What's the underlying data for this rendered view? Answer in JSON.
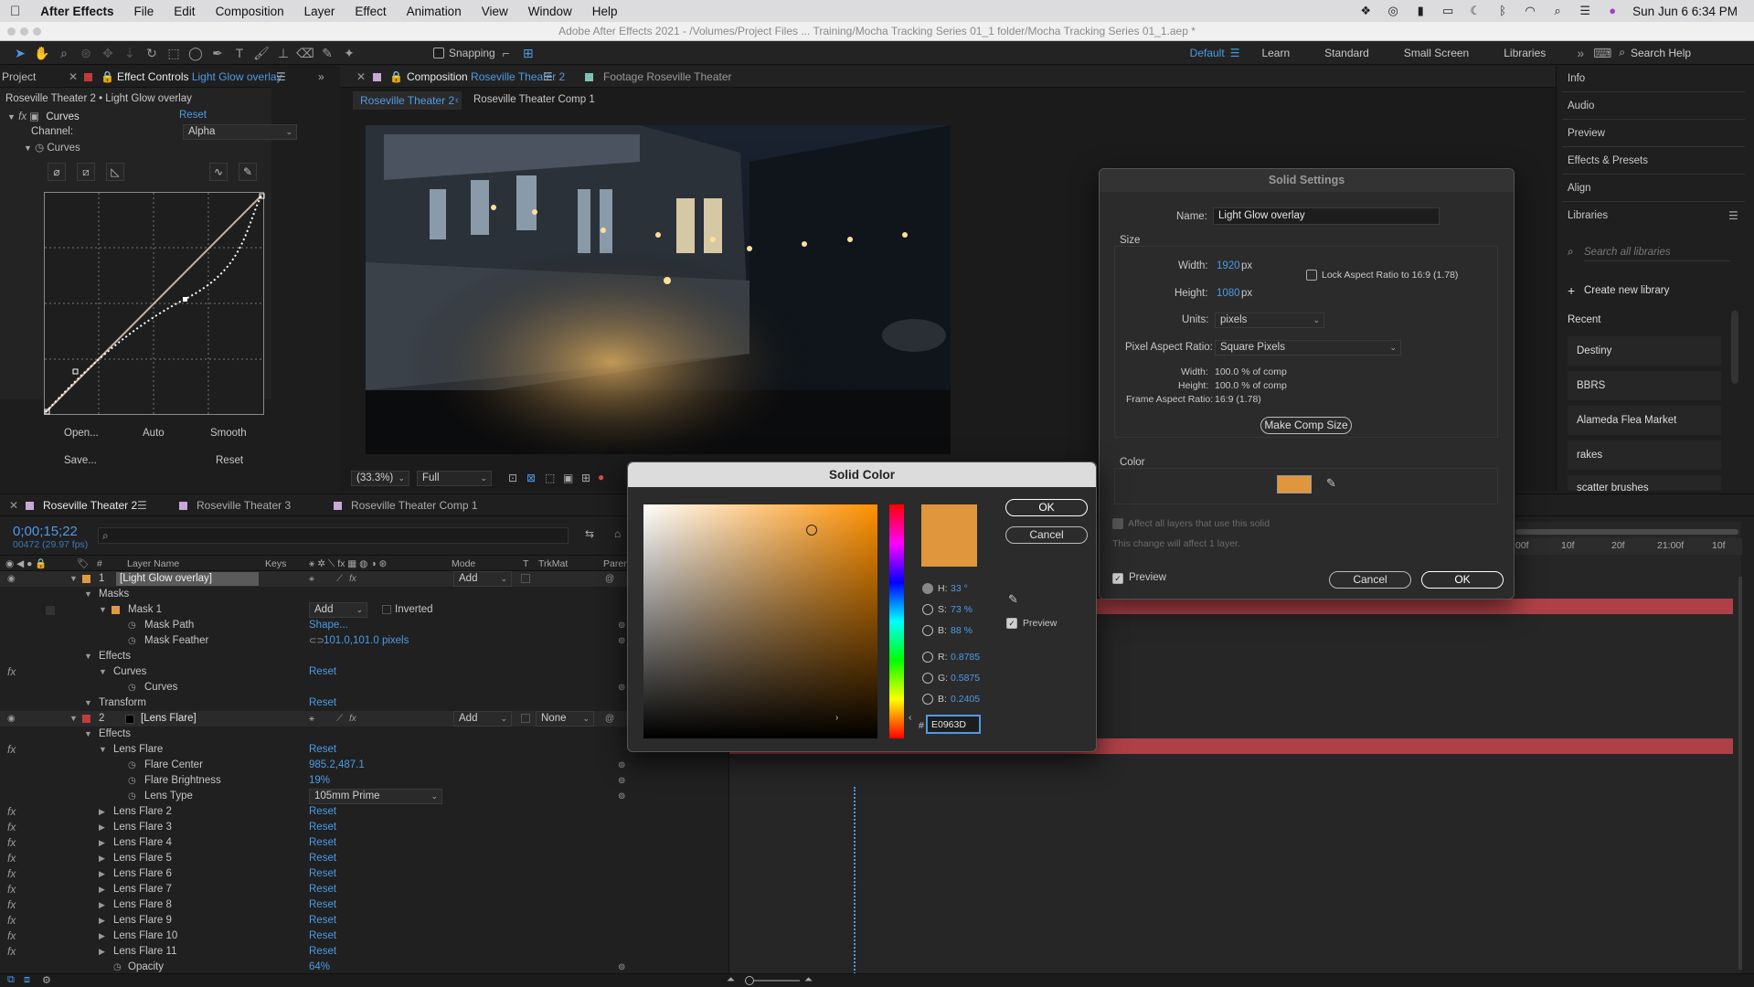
{
  "menubar": {
    "app": "After Effects",
    "items": [
      "File",
      "Edit",
      "Composition",
      "Layer",
      "Effect",
      "Animation",
      "View",
      "Window",
      "Help"
    ],
    "datetime": "Sun Jun 6  6:34 PM"
  },
  "titlebar": {
    "text": "Adobe After Effects 2021 - /Volumes/Project Files ... Training/Mocha Tracking Series 01_1 folder/Mocha Tracking Series 01_1.aep *"
  },
  "toolbar": {
    "snapping": "Snapping",
    "workspaces": [
      "Default",
      "Learn",
      "Standard",
      "Small Screen",
      "Libraries"
    ],
    "active_workspace": "Default",
    "search_help": "Search Help"
  },
  "left_panel": {
    "tab_project": "Project",
    "tab_effect_controls": "Effect Controls",
    "effect_layer": "Light Glow overlay",
    "header": "Roseville Theater 2 • Light Glow overlay",
    "effect_name": "Curves",
    "reset": "Reset",
    "channel_label": "Channel:",
    "channel_value": "Alpha",
    "curves_label": "Curves",
    "buttons": {
      "open": "Open...",
      "auto": "Auto",
      "smooth": "Smooth",
      "save": "Save...",
      "reset": "Reset"
    }
  },
  "composition": {
    "tab_label": "Composition",
    "comp_name": "Roseville Theater 2",
    "footage_tab": "Footage Roseville Theater",
    "breadcrumb_active": "Roseville Theater 2",
    "breadcrumb_next": "Roseville Theater Comp 1",
    "zoom": "(33.3%)",
    "resolution": "Full"
  },
  "right_panel": {
    "items": [
      "Info",
      "Audio",
      "Preview",
      "Effects & Presets",
      "Align",
      "Libraries"
    ],
    "search_placeholder": "Search all libraries",
    "create_library": "Create new library",
    "recent_label": "Recent",
    "libraries": [
      "Destiny",
      "BBRS",
      "Alameda Flea Market",
      "rakes",
      "scatter brushes"
    ]
  },
  "solid_settings": {
    "title": "Solid Settings",
    "name_label": "Name:",
    "name_value": "Light Glow overlay",
    "size_label": "Size",
    "width_label": "Width:",
    "width_value": "1920",
    "height_label": "Height:",
    "height_value": "1080",
    "px": "px",
    "lock_aspect": "Lock Aspect Ratio to 16:9 (1.78)",
    "units_label": "Units:",
    "units_value": "pixels",
    "par_label": "Pixel Aspect Ratio:",
    "par_value": "Square Pixels",
    "info_width_label": "Width:",
    "info_width_value": "100.0 % of comp",
    "info_height_label": "Height:",
    "info_height_value": "100.0 % of comp",
    "far_label": "Frame Aspect Ratio:",
    "far_value": "16:9 (1.78)",
    "make_comp_size": "Make Comp Size",
    "color_label": "Color",
    "swatch_color": "#E0963D",
    "affect_all": "Affect all layers that use this solid",
    "affect_note": "This change will affect 1 layer.",
    "preview": "Preview",
    "cancel": "Cancel",
    "ok": "OK"
  },
  "solid_color": {
    "title": "Solid Color",
    "ok": "OK",
    "cancel": "Cancel",
    "h_label": "H:",
    "h_value": "33 °",
    "s_label": "S:",
    "s_value": "73 %",
    "b_label": "B:",
    "b_value": "88 %",
    "r_label": "R:",
    "r_value": "0.8785",
    "g_label": "G:",
    "g_value": "0.5875",
    "b2_label": "B:",
    "b2_value": "0.2405",
    "preview": "Preview",
    "hash": "#",
    "hex": "E0963D",
    "color": "#E0963D"
  },
  "timeline": {
    "tabs": [
      "Roseville Theater 2",
      "Roseville Theater 3",
      "Roseville Theater Comp 1"
    ],
    "timecode": "0;00;15;22",
    "frame_info": "00472 (29.97 fps)",
    "col_hash": "#",
    "col_layer_name": "Layer Name",
    "col_keys": "Keys",
    "col_mode": "Mode",
    "col_t": "T",
    "col_trkmat": "TrkMat",
    "col_parent": "Paren",
    "ruler": [
      "00f",
      "10f",
      "20f",
      "21:00f",
      "10f"
    ],
    "layer1": {
      "num": "1",
      "name": "[Light Glow overlay]",
      "mode": "Add"
    },
    "masks": "Masks",
    "mask1": "Mask 1",
    "mask1_mode": "Add",
    "inverted": "Inverted",
    "mask_path": "Mask Path",
    "mask_path_value": "Shape...",
    "mask_feather": "Mask Feather",
    "mask_feather_value": "101.0,101.0 pixels",
    "effects": "Effects",
    "curves": "Curves",
    "curves_sub": "Curves",
    "transform": "Transform",
    "reset": "Reset",
    "layer2": {
      "num": "2",
      "name": "[Lens Flare]",
      "mode": "Add",
      "trkmat": "None"
    },
    "lens_flare": "Lens Flare",
    "flare_center": "Flare Center",
    "flare_center_value": "985.2,487.1",
    "flare_brightness": "Flare Brightness",
    "flare_brightness_value": "19%",
    "lens_type": "Lens Type",
    "lens_type_value": "105mm Prime",
    "flares": [
      "Lens Flare 2",
      "Lens Flare 3",
      "Lens Flare 4",
      "Lens Flare 5",
      "Lens Flare 6",
      "Lens Flare 7",
      "Lens Flare 8",
      "Lens Flare 9",
      "Lens Flare 10",
      "Lens Flare 11"
    ],
    "opacity": "Opacity",
    "opacity_value": "64%"
  }
}
